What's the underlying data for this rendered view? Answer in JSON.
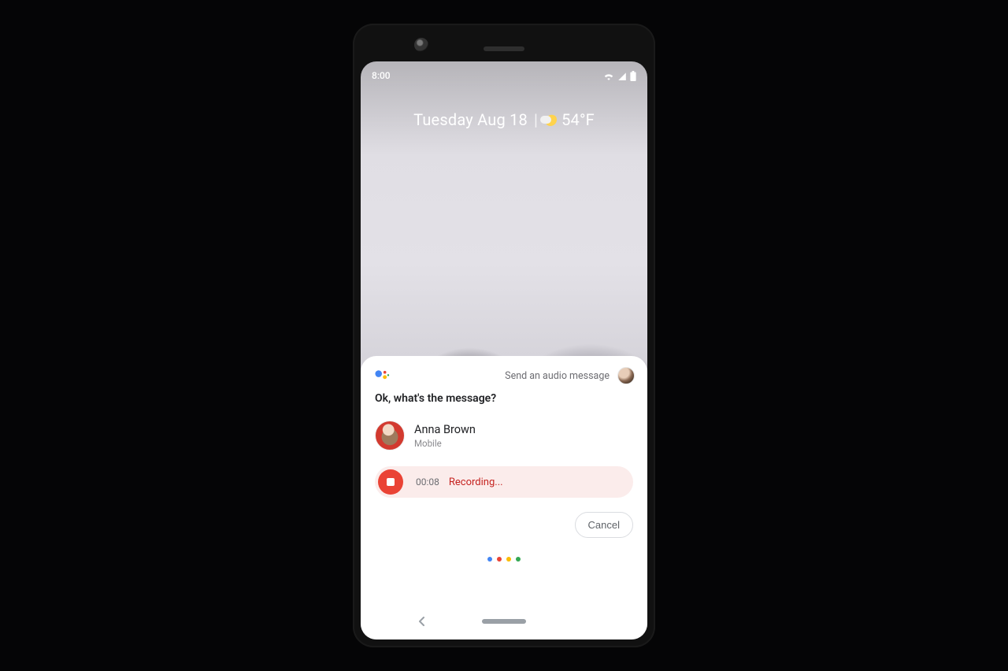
{
  "statusbar": {
    "time": "8:00"
  },
  "dateline": {
    "date": "Tuesday Aug 18",
    "separator": "|",
    "temperature": "54°F"
  },
  "assistant": {
    "header_hint": "Send an audio message",
    "prompt": "Ok, what's the message?",
    "contact": {
      "name": "Anna Brown",
      "line": "Mobile"
    },
    "recorder": {
      "elapsed": "00:08",
      "state": "Recording..."
    },
    "actions": {
      "cancel": "Cancel"
    }
  },
  "colors": {
    "google_blue": "#4285f4",
    "google_red": "#ea4335",
    "google_yellow": "#fbbc05",
    "google_green": "#34a853",
    "record_chip_bg": "#fbeceb"
  }
}
